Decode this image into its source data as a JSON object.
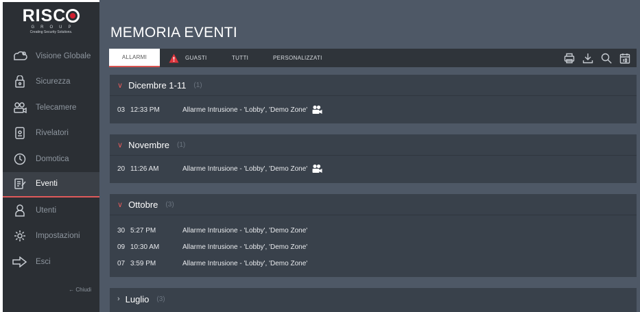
{
  "brand": {
    "name": "RISC",
    "group": "GROUP",
    "tagline": "Creating Security Solutions."
  },
  "sidebar": {
    "items": [
      {
        "label": "Visione Globale",
        "icon": "overview-icon"
      },
      {
        "label": "Sicurezza",
        "icon": "lock-icon"
      },
      {
        "label": "Telecamere",
        "icon": "camera-icon"
      },
      {
        "label": "Rivelatori",
        "icon": "detector-icon"
      },
      {
        "label": "Domotica",
        "icon": "automation-icon"
      },
      {
        "label": "Eventi",
        "icon": "events-icon",
        "active": true
      },
      {
        "label": "Utenti",
        "icon": "user-icon"
      },
      {
        "label": "Impostazioni",
        "icon": "gear-icon"
      },
      {
        "label": "Esci",
        "icon": "logout-icon"
      }
    ],
    "collapse_label": "← Chiudi"
  },
  "page": {
    "title": "MEMORIA EVENTI"
  },
  "tabs": [
    {
      "label": "ALLARMI",
      "active": true
    },
    {
      "label": "GUASTI",
      "icon": "warning-icon"
    },
    {
      "label": "TUTTI"
    },
    {
      "label": "PERSONALIZZATI"
    }
  ],
  "tools": [
    "print-icon",
    "download-icon",
    "search-icon",
    "calendar-icon"
  ],
  "groups": [
    {
      "title": "Dicembre 1-11",
      "count": "(1)",
      "expanded": true,
      "events": [
        {
          "day": "03",
          "time": "12:33 PM",
          "desc": "Allarme Intrusione - 'Lobby', 'Demo Zone'",
          "camera": true
        }
      ]
    },
    {
      "title": "Novembre",
      "count": "(1)",
      "expanded": true,
      "events": [
        {
          "day": "20",
          "time": "11:26 AM",
          "desc": "Allarme Intrusione - 'Lobby', 'Demo Zone'",
          "camera": true
        }
      ]
    },
    {
      "title": "Ottobre",
      "count": "(3)",
      "expanded": true,
      "events": [
        {
          "day": "30",
          "time": "5:27 PM",
          "desc": "Allarme Intrusione - 'Lobby', 'Demo Zone'",
          "camera": false
        },
        {
          "day": "09",
          "time": "10:30 AM",
          "desc": "Allarme Intrusione - 'Lobby', 'Demo Zone'",
          "camera": false
        },
        {
          "day": "07",
          "time": "3:59 PM",
          "desc": "Allarme Intrusione - 'Lobby', 'Demo Zone'",
          "camera": false
        }
      ]
    },
    {
      "title": "Luglio",
      "count": "(3)",
      "expanded": false,
      "events": []
    }
  ],
  "colors": {
    "sidebar_bg": "#2b2f34",
    "main_bg": "#4e5866",
    "panel_bg": "#39414b",
    "accent_red": "#e05a5a"
  }
}
